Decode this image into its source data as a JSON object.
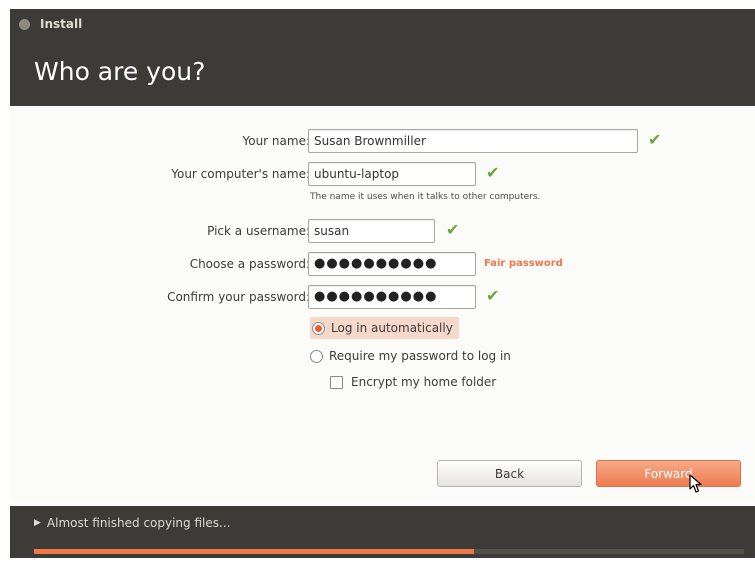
{
  "window": {
    "title": "Install"
  },
  "header": {
    "title": "Who are you?"
  },
  "form": {
    "name": {
      "label": "Your name:",
      "value": "Susan Brownmiller"
    },
    "computer": {
      "label": "Your computer's name:",
      "value": "ubuntu-laptop",
      "hint": "The name it uses when it talks to other computers."
    },
    "username": {
      "label": "Pick a username:",
      "value": "susan"
    },
    "password": {
      "label": "Choose a password:",
      "value": "●●●●●●●●●●",
      "strength": "Fair password"
    },
    "confirm": {
      "label": "Confirm your password:",
      "value": "●●●●●●●●●●"
    },
    "login_auto": {
      "label": "Log in automatically",
      "selected": true
    },
    "login_password": {
      "label": "Require my password to log in",
      "selected": false
    },
    "encrypt": {
      "label": "Encrypt my home folder",
      "checked": false
    }
  },
  "buttons": {
    "back": "Back",
    "forward": "Forward"
  },
  "footer": {
    "status": "Almost finished copying files...",
    "progress": 0.62
  },
  "colors": {
    "accent": "#f07746",
    "checkmark": "#6ea53a",
    "chrome": "#3c3b37"
  },
  "icons": {
    "close": "close-icon",
    "valid": "checkmark-icon",
    "expander": "expander-arrow-icon",
    "cursor": "mouse-cursor-icon"
  }
}
